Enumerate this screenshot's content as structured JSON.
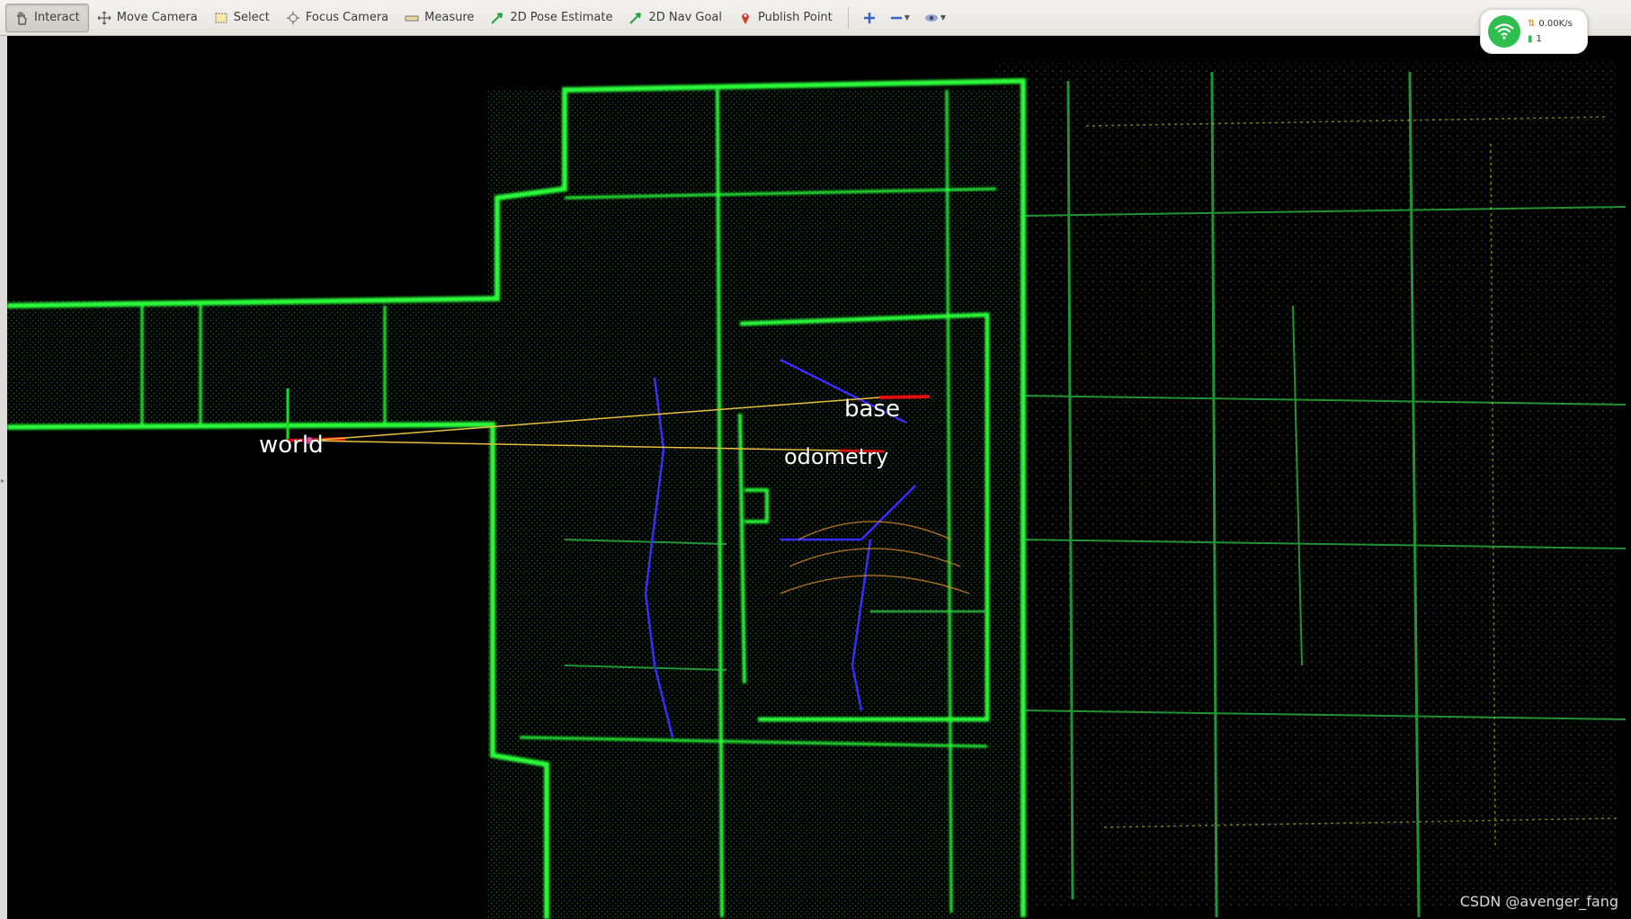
{
  "toolbar": {
    "tools": [
      {
        "label": "Interact",
        "icon": "hand-icon",
        "active": true
      },
      {
        "label": "Move Camera",
        "icon": "move-camera-icon"
      },
      {
        "label": "Select",
        "icon": "select-box-icon"
      },
      {
        "label": "Focus Camera",
        "icon": "focus-camera-icon"
      },
      {
        "label": "Measure",
        "icon": "ruler-icon"
      },
      {
        "label": "2D Pose Estimate",
        "icon": "green-arrow-icon"
      },
      {
        "label": "2D Nav Goal",
        "icon": "green-arrow-icon"
      },
      {
        "label": "Publish Point",
        "icon": "map-pin-icon"
      }
    ],
    "extra_icons": [
      "add-tool-icon",
      "remove-tool-icon",
      "view-options-icon"
    ]
  },
  "network_widget": {
    "speed": "0.00K/s",
    "count": "1",
    "accent": "#2fbf4f"
  },
  "frames": {
    "world": "world",
    "base": "base",
    "odometry": "odometry"
  },
  "watermark": "CSDN @avenger_fang",
  "colors": {
    "pointcloud_primary": "#2cff3a",
    "pointcloud_secondary": "#20c8c0",
    "pointcloud_tertiary": "#d6e020",
    "path": "#3a2cff"
  }
}
